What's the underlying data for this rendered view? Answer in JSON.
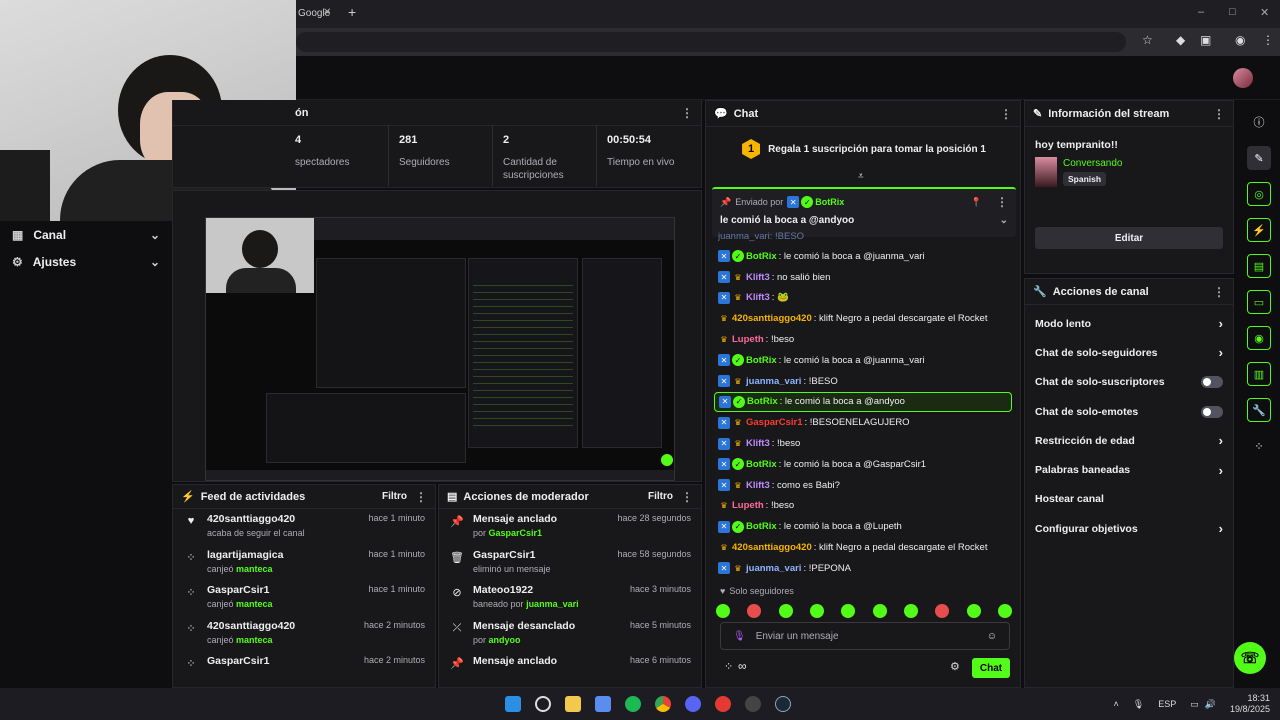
{
  "browser": {
    "tab_title": "Google",
    "new_tab": "+",
    "window_buttons": [
      "–",
      "□",
      "✕"
    ]
  },
  "sidebar": {
    "items": [
      {
        "label": "Canal"
      },
      {
        "label": "Ajustes"
      }
    ]
  },
  "stats_panel": {
    "title": "ón",
    "items": [
      {
        "value": "4",
        "label": "spectadores"
      },
      {
        "value": "281",
        "label": "Seguidores"
      },
      {
        "value": "2",
        "label": "Cantidad de suscripciones"
      },
      {
        "value": "00:50:54",
        "label": "Tiempo en vivo"
      }
    ]
  },
  "activity_feed": {
    "title": "Feed de actividades",
    "filter": "Filtro",
    "items": [
      {
        "icon": "heart-icon",
        "user": "420santtiaggo420",
        "action": "acaba de seguir el canal",
        "reward": "",
        "time": "hace 1 minuto"
      },
      {
        "icon": "points-icon",
        "user": "lagartijamagica",
        "action": "canjeó",
        "reward": "manteca",
        "time": "hace 1 minuto"
      },
      {
        "icon": "points-icon",
        "user": "GasparCsir1",
        "action": "canjeó",
        "reward": "manteca",
        "time": "hace 1 minuto"
      },
      {
        "icon": "points-icon",
        "user": "420santtiaggo420",
        "action": "canjeó",
        "reward": "manteca",
        "time": "hace 2 minutos"
      },
      {
        "icon": "points-icon",
        "user": "GasparCsir1",
        "action": "",
        "reward": "",
        "time": "hace 2 minutos"
      }
    ]
  },
  "mod_actions": {
    "title": "Acciones de moderador",
    "filter": "Filtro",
    "items": [
      {
        "icon": "pin-icon",
        "title": "Mensaje anclado",
        "prefix": "por",
        "user": "GasparCsir1",
        "time": "hace 28 segundos"
      },
      {
        "icon": "trash-icon",
        "title": "GasparCsir1",
        "prefix": "eliminó un mensaje",
        "user": "",
        "time": "hace 58 segundos"
      },
      {
        "icon": "ban-icon",
        "title": "Mateoo1922",
        "prefix": "baneado por",
        "user": "juanma_vari",
        "time": "hace 3 minutos"
      },
      {
        "icon": "unpin-icon",
        "title": "Mensaje desanclado",
        "prefix": "por",
        "user": "andyoo",
        "time": "hace 5 minutos"
      },
      {
        "icon": "pin-icon",
        "title": "Mensaje anclado",
        "prefix": "",
        "user": "",
        "time": "hace 6 minutos"
      }
    ]
  },
  "chat": {
    "title": "Chat",
    "sub_goal_rank": "1",
    "sub_goal_text": "Regala 1 suscripción para tomar la posición 1",
    "pinned": {
      "sent_by_label": "Enviado por",
      "user": "BotRix",
      "message": "le comió la boca a @andyoo"
    },
    "partial_top": "juanma_vari: !BESO",
    "messages": [
      {
        "user": "BotRix",
        "color": "#53fc18",
        "text": ": le comió la boca a @juanma_vari",
        "badges": [
          "blue",
          "verify"
        ],
        "highlight": false
      },
      {
        "user": "Klift3",
        "color": "#c08aff",
        "text": ": no salió bien",
        "badges": [
          "blue",
          "gold"
        ],
        "highlight": false
      },
      {
        "user": "Klift3",
        "color": "#c08aff",
        "text": ": 🐸",
        "badges": [
          "blue",
          "gold"
        ],
        "highlight": false
      },
      {
        "user": "420santtiaggo420",
        "color": "#f7b500",
        "text": ": klift Negro a pedal descargate el Rocket",
        "badges": [
          "gold"
        ],
        "highlight": false
      },
      {
        "user": "Lupeth",
        "color": "#ff6b9a",
        "text": ": !beso",
        "badges": [
          "gold"
        ],
        "highlight": false
      },
      {
        "user": "BotRix",
        "color": "#53fc18",
        "text": ": le comió la boca a @juanma_vari",
        "badges": [
          "blue",
          "verify"
        ],
        "highlight": false
      },
      {
        "user": "juanma_vari",
        "color": "#8fb4ff",
        "text": ": !BESO",
        "badges": [
          "blue",
          "gold"
        ],
        "highlight": false
      },
      {
        "user": "BotRix",
        "color": "#53fc18",
        "text": ": le comió la boca a @andyoo",
        "badges": [
          "blue",
          "verify"
        ],
        "highlight": true
      },
      {
        "user": "GasparCsir1",
        "color": "#ff3b30",
        "text": ": !BESOENELAGUJERO",
        "badges": [
          "blue",
          "gold"
        ],
        "highlight": false
      },
      {
        "user": "Klift3",
        "color": "#c08aff",
        "text": ": !beso",
        "badges": [
          "blue",
          "gold"
        ],
        "highlight": false
      },
      {
        "user": "BotRix",
        "color": "#53fc18",
        "text": ": le comió la boca a @GasparCsir1",
        "badges": [
          "blue",
          "verify"
        ],
        "highlight": false
      },
      {
        "user": "Klift3",
        "color": "#c08aff",
        "text": ": como es Babi?",
        "badges": [
          "blue",
          "gold"
        ],
        "highlight": false
      },
      {
        "user": "Lupeth",
        "color": "#ff6b9a",
        "text": ": !beso",
        "badges": [
          "gold"
        ],
        "highlight": false
      },
      {
        "user": "BotRix",
        "color": "#53fc18",
        "text": ": le comió la boca a @Lupeth",
        "badges": [
          "blue",
          "verify"
        ],
        "highlight": false
      },
      {
        "user": "420santtiaggo420",
        "color": "#f7b500",
        "text": ": klift Negro a pedal descargate el Rocket",
        "badges": [
          "gold"
        ],
        "highlight": false
      },
      {
        "user": "juanma_vari",
        "color": "#8fb4ff",
        "text": ": !PEPONA",
        "badges": [
          "blue",
          "gold"
        ],
        "highlight": false
      }
    ],
    "mode_label": "Solo seguidores",
    "input_placeholder": "Enviar un mensaje",
    "send_button": "Chat"
  },
  "stream_info": {
    "title": "Información del stream",
    "stream_title": "hoy tempranito!!",
    "category": "Conversando",
    "language": "Spanish",
    "edit_button": "Editar"
  },
  "channel_actions": {
    "title": "Acciones de canal",
    "items": [
      {
        "label": "Modo lento",
        "control": "arrow"
      },
      {
        "label": "Chat de solo-seguidores",
        "control": "arrow"
      },
      {
        "label": "Chat de solo-suscriptores",
        "control": "toggle"
      },
      {
        "label": "Chat de solo-emotes",
        "control": "toggle"
      },
      {
        "label": "Restricción de edad",
        "control": "arrow"
      },
      {
        "label": "Palabras baneadas",
        "control": "arrow"
      },
      {
        "label": "Hostear canal",
        "control": "none"
      },
      {
        "label": "Configurar objetivos",
        "control": "arrow"
      }
    ]
  },
  "taskbar": {
    "lang": "ESP",
    "time": "18:31",
    "date": "19/8/2025"
  },
  "colors": {
    "accent": "#53fc18",
    "bg": "#0e0e10",
    "panel": "#18181b"
  }
}
